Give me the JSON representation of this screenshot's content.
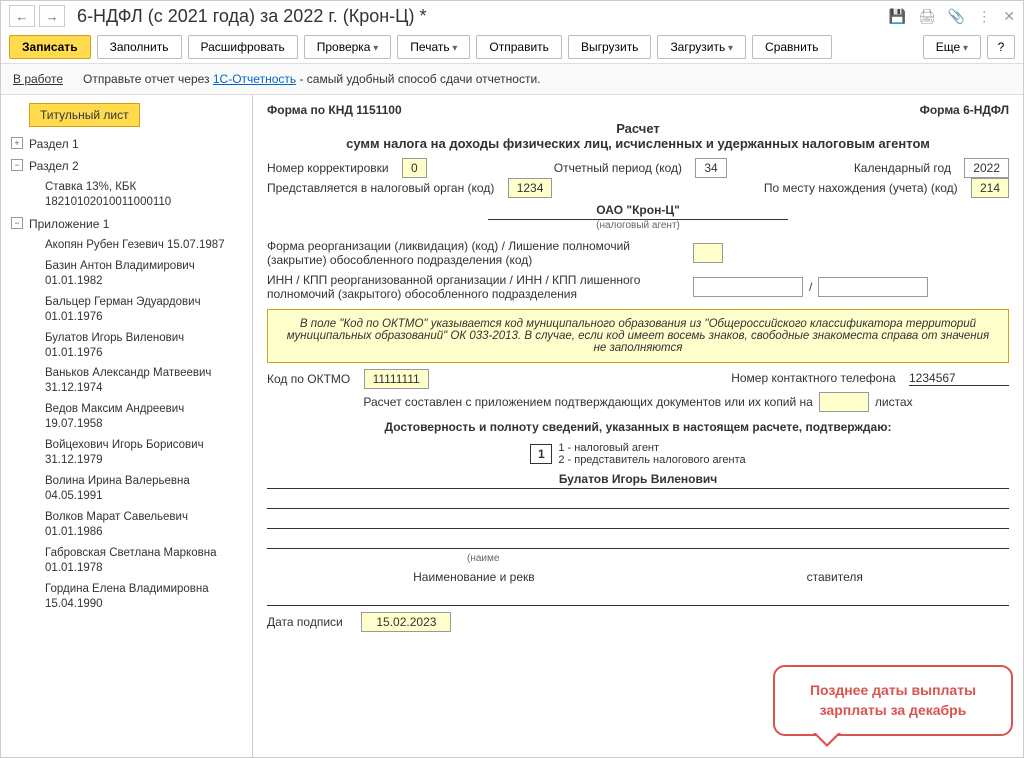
{
  "titlebar": {
    "title": "6-НДФЛ (с 2021 года) за 2022 г. (Крон-Ц) *"
  },
  "toolbar": {
    "save": "Записать",
    "fill": "Заполнить",
    "decrypt": "Расшифровать",
    "check": "Проверка",
    "print": "Печать",
    "send": "Отправить",
    "export": "Выгрузить",
    "import": "Загрузить",
    "compare": "Сравнить",
    "more": "Еще",
    "help": "?"
  },
  "infobar": {
    "status": "В работе",
    "text1": "Отправьте отчет через ",
    "link": "1С-Отчетность",
    "text2": " - самый удобный способ сдачи отчетности."
  },
  "tree": {
    "tab": "Титульный лист",
    "section1": "Раздел 1",
    "section2": "Раздел 2",
    "rate_kbk": "Ставка 13%, КБК 18210102010011000110",
    "appendix": "Приложение 1",
    "people": [
      "Акопян Рубен Гезевич 15.07.1987",
      "Базин Антон Владимирович 01.01.1982",
      "Бальцер Герман Эдуардович 01.01.1976",
      "Булатов Игорь Виленович 01.01.1976",
      "Ваньков Александр Матвеевич 31.12.1974",
      "Ведов Максим Андреевич 19.07.1958",
      "Войцехович Игорь Борисович 31.12.1979",
      "Волина Ирина Валерьевна 04.05.1991",
      "Волков Марат Савельевич 01.01.1986",
      "Габровская Светлана Марковна 01.01.1978",
      "Гордина Елена Владимировна 15.04.1990"
    ]
  },
  "form": {
    "knd": "Форма по КНД 1151100",
    "form_code": "Форма 6-НДФЛ",
    "main_title": "Расчет",
    "subtitle": "сумм налога на доходы физических лиц, исчисленных и удержанных налоговым агентом",
    "corr_label": "Номер корректировки",
    "corr_val": "0",
    "period_label": "Отчетный период (код)",
    "period_val": "34",
    "year_label": "Календарный год",
    "year_val": "2022",
    "tax_auth_label": "Представляется в налоговый орган (код)",
    "tax_auth_val": "1234",
    "location_label": "По месту нахождения (учета) (код)",
    "location_val": "214",
    "org_name": "ОАО \"Крон-Ц\"",
    "org_hint": "(налоговый агент)",
    "reorg_label": "Форма реорганизации (ликвидация) (код) / Лишение полномочий (закрытие) обособленного подразделения (код)",
    "inn_kpp_label": "ИНН / КПП реорганизованной организации / ИНН / КПП лишенного полномочий (закрытого) обособленного подразделения",
    "oktmo_note": "В поле \"Код по ОКТМО\" указывается код муниципального образования из \"Общероссийского классификатора территорий муниципальных образований\" ОК 033-2013. В случае, если код имеет восемь знаков, свободные знакоместа справа от значения не заполняются",
    "oktmo_label": "Код по ОКТМО",
    "oktmo_val": "11111111",
    "phone_label": "Номер контактного телефона",
    "phone_val": "1234567",
    "sheets_label1": "Расчет составлен с приложением подтверждающих документов или их копий на",
    "sheets_label2": "листах",
    "confirm_title": "Достоверность и полноту сведений, указанных в настоящем расчете, подтверждаю:",
    "confirm_opt": "1",
    "confirm_opt1": "1 - налоговый агент",
    "confirm_opt2": "2 - представитель налогового агента",
    "signer": "Булатов Игорь Виленович",
    "naim_hint": "(наиме",
    "repr_doc_label": "Наименование и рекв",
    "repr_doc_tail": "ставителя",
    "sign_date_label": "Дата подписи",
    "sign_date_val": "15.02.2023"
  },
  "bubble": {
    "text": "Позднее даты выплаты зарплаты за декабрь"
  }
}
